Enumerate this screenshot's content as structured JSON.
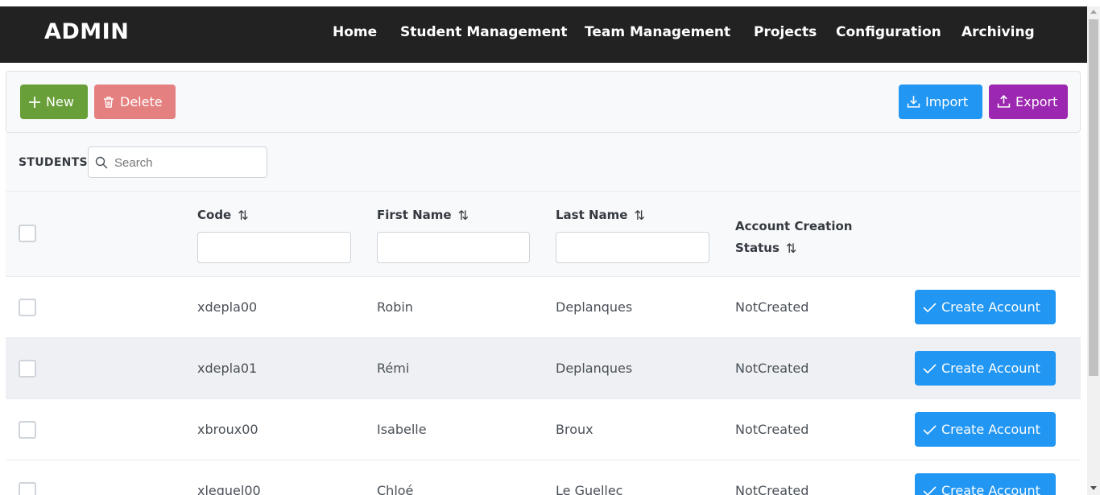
{
  "navbar": {
    "brand": "ADMIN",
    "items": [
      "Home",
      "Student Management",
      "Team Management",
      "Projects",
      "Configuration",
      "Archiving"
    ]
  },
  "toolbar": {
    "new_label": "New",
    "delete_label": "Delete",
    "import_label": "Import",
    "export_label": "Export"
  },
  "table": {
    "title": "STUDENTS",
    "search_placeholder": "Search",
    "columns": {
      "code": "Code",
      "first_name": "First Name",
      "last_name": "Last Name",
      "status_line1": "Account Creation",
      "status_line2": "Status"
    },
    "rows": [
      {
        "code": "xdepla00",
        "first_name": "Robin",
        "last_name": "Deplanques",
        "status": "NotCreated",
        "action": "Create Account"
      },
      {
        "code": "xdepla01",
        "first_name": "Rémi",
        "last_name": "Deplanques",
        "status": "NotCreated",
        "action": "Create Account"
      },
      {
        "code": "xbroux00",
        "first_name": "Isabelle",
        "last_name": "Broux",
        "status": "NotCreated",
        "action": "Create Account"
      },
      {
        "code": "xleguel00",
        "first_name": "Chloé",
        "last_name": "Le Guellec",
        "status": "NotCreated",
        "action": "Create Account"
      }
    ]
  },
  "colors": {
    "navbar_bg": "#222222",
    "new_button": "#689f38",
    "delete_button": "#e58080",
    "import_button": "#2196f3",
    "export_button": "#9c27b0",
    "create_account_button": "#2196f3"
  },
  "icons": {
    "new": "plus-icon",
    "delete": "trash-icon",
    "import": "download-icon",
    "export": "upload-icon",
    "search": "search-icon",
    "sort": "sort-icon",
    "create": "check-icon"
  }
}
